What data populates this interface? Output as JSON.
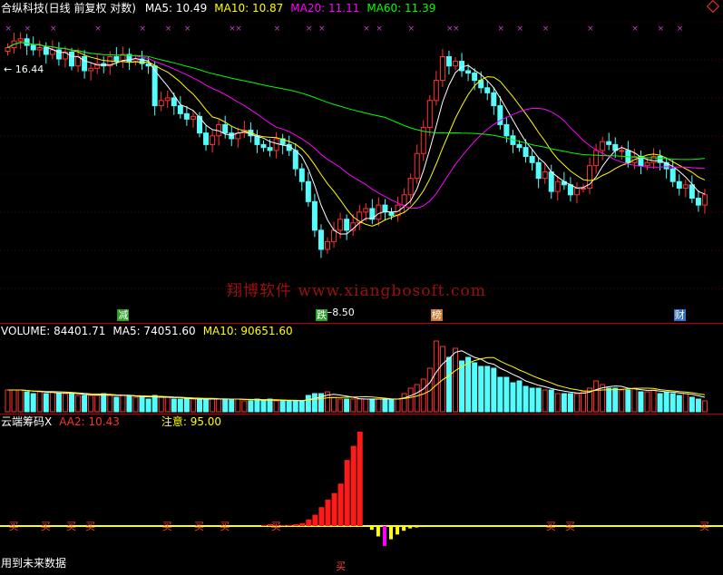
{
  "price_panel": {
    "title": "合纵科技(日线 前复权 对数)",
    "ma_labels": [
      {
        "text": "MA5: 10.49",
        "color": "#ffffff"
      },
      {
        "text": "MA10: 10.87",
        "color": "#ffff00"
      },
      {
        "text": "MA20: 11.11",
        "color": "#ff00ff"
      },
      {
        "text": "MA60: 11.39",
        "color": "#00ff00"
      }
    ],
    "high_label": "16.44",
    "low_label": "8.50",
    "badges": [
      {
        "text": "减",
        "bg": "#2aa02a",
        "fg": "#ffffff",
        "idx": 18
      },
      {
        "text": "跌",
        "bg": "#2aa02a",
        "fg": "#ffffff",
        "idx": 49
      },
      {
        "text": "榜",
        "bg": "#c87828",
        "fg": "#ffffff",
        "idx": 67
      },
      {
        "text": "财",
        "bg": "#3070c0",
        "fg": "#ffffff",
        "idx": 105
      }
    ],
    "ylim": [
      8.2,
      17.2
    ],
    "corner_icon": "diamond-icon"
  },
  "volume_panel": {
    "labels": [
      {
        "text": "VOLUME: 84401.71",
        "color": "#ffffff"
      },
      {
        "text": "MA5: 74051.60",
        "color": "#ffffff"
      },
      {
        "text": "MA10: 90651.60",
        "color": "#ffff00"
      }
    ]
  },
  "indicator_panel": {
    "labels": [
      {
        "text": "云端筹码X",
        "color": "#ffffff"
      },
      {
        "text": "AA2: 10.43",
        "color": "#ff3030"
      },
      {
        "text": "注意: 95.00",
        "color": "#ffff00"
      }
    ],
    "buy_text": "买",
    "bottom_text": "用到未来数据"
  },
  "watermark": "翔博软件 www.xiangbosoft.com",
  "colors": {
    "up": "#ff3232",
    "down": "#54fcfc",
    "ma5": "#ffffff",
    "ma10": "#ffff00",
    "ma20": "#ff00ff",
    "ma60": "#00ff00",
    "sep": "#b00000"
  },
  "chart_data": {
    "type": "candlestick",
    "series": [
      {
        "name": "price",
        "values": [
          16.0,
          16.3,
          16.4,
          16.1,
          15.9,
          16.0,
          15.7,
          15.9,
          15.5,
          15.8,
          15.2,
          15.6,
          15.0,
          15.1,
          15.3,
          15.2,
          15.6,
          15.4,
          15.7,
          15.4,
          15.5,
          15.3,
          15.2,
          13.6,
          13.8,
          13.9,
          13.6,
          13.3,
          13.1,
          13.2,
          12.6,
          12.2,
          12.5,
          12.9,
          12.6,
          12.4,
          12.6,
          12.7,
          12.5,
          12.2,
          12.1,
          12.0,
          12.4,
          12.2,
          12.0,
          11.4,
          11.0,
          10.4,
          9.6,
          9.1,
          9.3,
          9.6,
          9.9,
          9.6,
          9.8,
          10.1,
          10.2,
          9.9,
          10.3,
          10.1,
          10.0,
          10.3,
          10.6,
          11.1,
          11.9,
          12.8,
          13.8,
          14.6,
          15.6,
          15.2,
          15.4,
          15.0,
          14.9,
          14.6,
          14.3,
          14.1,
          13.6,
          12.9,
          12.5,
          12.2,
          12.1,
          11.8,
          11.6,
          11.1,
          11.3,
          10.7,
          11.0,
          10.9,
          10.6,
          10.8,
          10.8,
          11.5,
          12.0,
          12.3,
          12.2,
          12.0,
          12.0,
          11.6,
          11.8,
          11.5,
          11.6,
          11.8,
          11.6,
          11.4,
          11.0,
          10.8,
          10.9,
          10.5,
          10.3,
          10.6
        ]
      },
      {
        "name": "volume",
        "values": [
          12,
          12,
          12,
          11,
          10,
          11,
          10,
          11,
          10,
          10,
          10,
          9,
          9,
          9,
          9,
          10,
          9,
          8,
          9,
          9,
          8,
          8,
          7,
          9,
          8,
          8,
          7,
          7,
          7,
          7,
          7,
          7,
          7,
          7,
          7,
          7,
          7,
          6,
          6,
          7,
          6,
          7,
          6,
          6,
          6,
          6,
          6,
          9,
          10,
          10,
          11,
          8,
          7,
          7,
          7,
          7,
          7,
          7,
          7,
          7,
          7,
          7,
          10,
          13,
          15,
          18,
          24,
          39,
          36,
          30,
          35,
          28,
          30,
          27,
          25,
          25,
          24,
          19,
          19,
          16,
          17,
          14,
          13,
          13,
          12,
          12,
          10,
          10,
          10,
          10,
          11,
          13,
          17,
          15,
          13,
          13,
          12,
          12,
          13,
          11,
          11,
          12,
          10,
          11,
          10,
          9,
          10,
          8,
          7,
          6
        ]
      },
      {
        "name": "AA2",
        "values": [
          0,
          0,
          0,
          0,
          0,
          0,
          0,
          0,
          0,
          0,
          0,
          0,
          0,
          0,
          0,
          0,
          0,
          0,
          0,
          0,
          0,
          0,
          0,
          0,
          0,
          0,
          0,
          0,
          0,
          0,
          0,
          0,
          0,
          0,
          0,
          0,
          0,
          0,
          0,
          0,
          1,
          2,
          1,
          1,
          1,
          2,
          3,
          7,
          12,
          20,
          28,
          35,
          45,
          70,
          85,
          100,
          0,
          -8,
          -22,
          -42,
          -28,
          -18,
          -10,
          -5,
          -3,
          -2,
          -1,
          0,
          0,
          0,
          0,
          0,
          0,
          0,
          0,
          0,
          0,
          0,
          0,
          0,
          0,
          0,
          0,
          0,
          0,
          0,
          0,
          0,
          0,
          0,
          0,
          0,
          0,
          0,
          0,
          0,
          0,
          0,
          0,
          0,
          0,
          0,
          0,
          0,
          0,
          0,
          0,
          0,
          0,
          0
        ]
      }
    ]
  }
}
